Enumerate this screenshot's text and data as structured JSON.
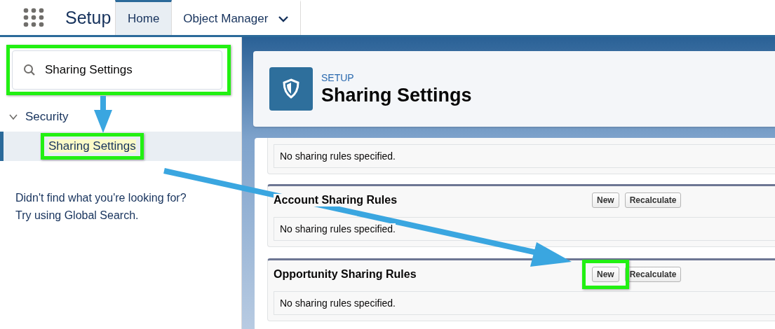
{
  "header": {
    "app_name": "Setup",
    "tabs": [
      {
        "label": "Home",
        "selected": true,
        "dropdown": false
      },
      {
        "label": "Object Manager",
        "selected": false,
        "dropdown": true
      }
    ]
  },
  "sidebar": {
    "search": {
      "value": "Sharing Settings",
      "highlighted": true
    },
    "tree": [
      {
        "label": "Security",
        "expanded": true,
        "children": [
          {
            "label": "Sharing Settings",
            "selected": true,
            "match": true,
            "highlighted": true
          }
        ]
      }
    ],
    "help_text": [
      "Didn't find what you're looking for?",
      "Try using Global Search."
    ]
  },
  "page_header": {
    "eyebrow": "SETUP",
    "title": "Sharing Settings"
  },
  "sections": [
    {
      "empty_text": "No sharing rules specified."
    },
    {
      "title": "Account Sharing Rules",
      "buttons": [
        {
          "label": "New",
          "highlighted": false
        },
        {
          "label": "Recalculate",
          "highlighted": false
        }
      ],
      "empty_text": "No sharing rules specified."
    },
    {
      "title": "Opportunity Sharing Rules",
      "buttons": [
        {
          "label": "New",
          "highlighted": true
        },
        {
          "label": "Recalculate",
          "highlighted": false
        }
      ],
      "empty_text": "No sharing rules specified."
    }
  ]
}
